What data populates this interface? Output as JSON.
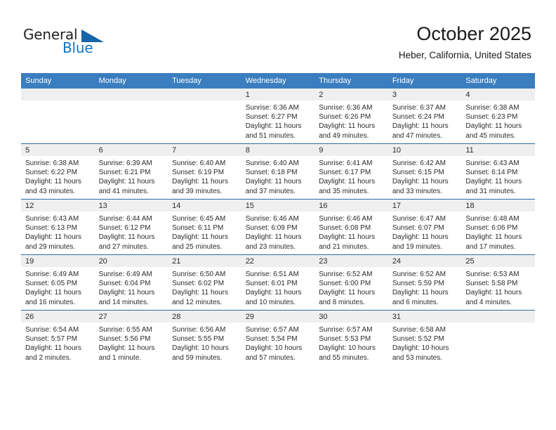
{
  "brand": {
    "name_part1": "General",
    "name_part2": "Blue",
    "accent_color": "#1175c0",
    "triangle_color": "#1565a8"
  },
  "header": {
    "month_title": "October 2025",
    "location": "Heber, California, United States"
  },
  "calendar": {
    "header_bg": "#3a7ebf",
    "row_divider_color": "#2e6da4",
    "daynum_bg": "#efefef",
    "weekdays": [
      "Sunday",
      "Monday",
      "Tuesday",
      "Wednesday",
      "Thursday",
      "Friday",
      "Saturday"
    ],
    "weeks": [
      [
        {
          "day": "",
          "empty": true
        },
        {
          "day": "",
          "empty": true
        },
        {
          "day": "",
          "empty": true
        },
        {
          "day": "1",
          "sunrise": "Sunrise: 6:36 AM",
          "sunset": "Sunset: 6:27 PM",
          "daylight": "Daylight: 11 hours and 51 minutes."
        },
        {
          "day": "2",
          "sunrise": "Sunrise: 6:36 AM",
          "sunset": "Sunset: 6:26 PM",
          "daylight": "Daylight: 11 hours and 49 minutes."
        },
        {
          "day": "3",
          "sunrise": "Sunrise: 6:37 AM",
          "sunset": "Sunset: 6:24 PM",
          "daylight": "Daylight: 11 hours and 47 minutes."
        },
        {
          "day": "4",
          "sunrise": "Sunrise: 6:38 AM",
          "sunset": "Sunset: 6:23 PM",
          "daylight": "Daylight: 11 hours and 45 minutes."
        }
      ],
      [
        {
          "day": "5",
          "sunrise": "Sunrise: 6:38 AM",
          "sunset": "Sunset: 6:22 PM",
          "daylight": "Daylight: 11 hours and 43 minutes."
        },
        {
          "day": "6",
          "sunrise": "Sunrise: 6:39 AM",
          "sunset": "Sunset: 6:21 PM",
          "daylight": "Daylight: 11 hours and 41 minutes."
        },
        {
          "day": "7",
          "sunrise": "Sunrise: 6:40 AM",
          "sunset": "Sunset: 6:19 PM",
          "daylight": "Daylight: 11 hours and 39 minutes."
        },
        {
          "day": "8",
          "sunrise": "Sunrise: 6:40 AM",
          "sunset": "Sunset: 6:18 PM",
          "daylight": "Daylight: 11 hours and 37 minutes."
        },
        {
          "day": "9",
          "sunrise": "Sunrise: 6:41 AM",
          "sunset": "Sunset: 6:17 PM",
          "daylight": "Daylight: 11 hours and 35 minutes."
        },
        {
          "day": "10",
          "sunrise": "Sunrise: 6:42 AM",
          "sunset": "Sunset: 6:15 PM",
          "daylight": "Daylight: 11 hours and 33 minutes."
        },
        {
          "day": "11",
          "sunrise": "Sunrise: 6:43 AM",
          "sunset": "Sunset: 6:14 PM",
          "daylight": "Daylight: 11 hours and 31 minutes."
        }
      ],
      [
        {
          "day": "12",
          "sunrise": "Sunrise: 6:43 AM",
          "sunset": "Sunset: 6:13 PM",
          "daylight": "Daylight: 11 hours and 29 minutes."
        },
        {
          "day": "13",
          "sunrise": "Sunrise: 6:44 AM",
          "sunset": "Sunset: 6:12 PM",
          "daylight": "Daylight: 11 hours and 27 minutes."
        },
        {
          "day": "14",
          "sunrise": "Sunrise: 6:45 AM",
          "sunset": "Sunset: 6:11 PM",
          "daylight": "Daylight: 11 hours and 25 minutes."
        },
        {
          "day": "15",
          "sunrise": "Sunrise: 6:46 AM",
          "sunset": "Sunset: 6:09 PM",
          "daylight": "Daylight: 11 hours and 23 minutes."
        },
        {
          "day": "16",
          "sunrise": "Sunrise: 6:46 AM",
          "sunset": "Sunset: 6:08 PM",
          "daylight": "Daylight: 11 hours and 21 minutes."
        },
        {
          "day": "17",
          "sunrise": "Sunrise: 6:47 AM",
          "sunset": "Sunset: 6:07 PM",
          "daylight": "Daylight: 11 hours and 19 minutes."
        },
        {
          "day": "18",
          "sunrise": "Sunrise: 6:48 AM",
          "sunset": "Sunset: 6:06 PM",
          "daylight": "Daylight: 11 hours and 17 minutes."
        }
      ],
      [
        {
          "day": "19",
          "sunrise": "Sunrise: 6:49 AM",
          "sunset": "Sunset: 6:05 PM",
          "daylight": "Daylight: 11 hours and 16 minutes."
        },
        {
          "day": "20",
          "sunrise": "Sunrise: 6:49 AM",
          "sunset": "Sunset: 6:04 PM",
          "daylight": "Daylight: 11 hours and 14 minutes."
        },
        {
          "day": "21",
          "sunrise": "Sunrise: 6:50 AM",
          "sunset": "Sunset: 6:02 PM",
          "daylight": "Daylight: 11 hours and 12 minutes."
        },
        {
          "day": "22",
          "sunrise": "Sunrise: 6:51 AM",
          "sunset": "Sunset: 6:01 PM",
          "daylight": "Daylight: 11 hours and 10 minutes."
        },
        {
          "day": "23",
          "sunrise": "Sunrise: 6:52 AM",
          "sunset": "Sunset: 6:00 PM",
          "daylight": "Daylight: 11 hours and 8 minutes."
        },
        {
          "day": "24",
          "sunrise": "Sunrise: 6:52 AM",
          "sunset": "Sunset: 5:59 PM",
          "daylight": "Daylight: 11 hours and 6 minutes."
        },
        {
          "day": "25",
          "sunrise": "Sunrise: 6:53 AM",
          "sunset": "Sunset: 5:58 PM",
          "daylight": "Daylight: 11 hours and 4 minutes."
        }
      ],
      [
        {
          "day": "26",
          "sunrise": "Sunrise: 6:54 AM",
          "sunset": "Sunset: 5:57 PM",
          "daylight": "Daylight: 11 hours and 2 minutes."
        },
        {
          "day": "27",
          "sunrise": "Sunrise: 6:55 AM",
          "sunset": "Sunset: 5:56 PM",
          "daylight": "Daylight: 11 hours and 1 minute."
        },
        {
          "day": "28",
          "sunrise": "Sunrise: 6:56 AM",
          "sunset": "Sunset: 5:55 PM",
          "daylight": "Daylight: 10 hours and 59 minutes."
        },
        {
          "day": "29",
          "sunrise": "Sunrise: 6:57 AM",
          "sunset": "Sunset: 5:54 PM",
          "daylight": "Daylight: 10 hours and 57 minutes."
        },
        {
          "day": "30",
          "sunrise": "Sunrise: 6:57 AM",
          "sunset": "Sunset: 5:53 PM",
          "daylight": "Daylight: 10 hours and 55 minutes."
        },
        {
          "day": "31",
          "sunrise": "Sunrise: 6:58 AM",
          "sunset": "Sunset: 5:52 PM",
          "daylight": "Daylight: 10 hours and 53 minutes."
        },
        {
          "day": "",
          "empty": true
        }
      ]
    ]
  }
}
